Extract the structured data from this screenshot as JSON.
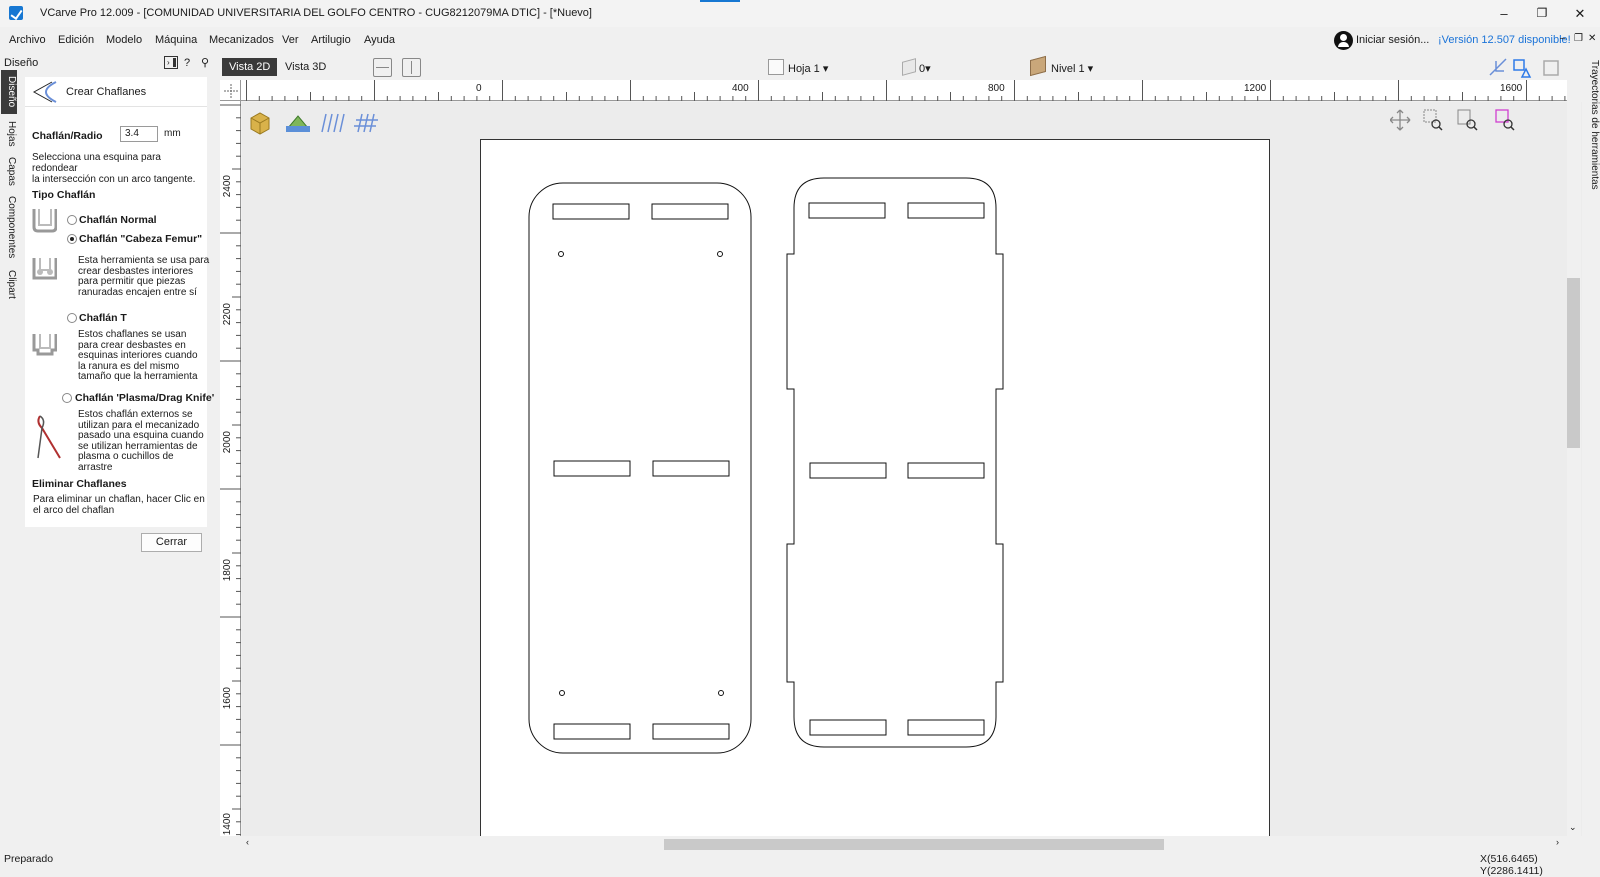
{
  "window": {
    "title": "VCarve Pro 12.009 - [COMUNIDAD UNIVERSITARIA DEL GOLFO CENTRO - CUG8212079MA DTIC] - [*Nuevo]",
    "minimize": "–",
    "restore": "❐",
    "close": "✕"
  },
  "menu": {
    "items": [
      "Archivo",
      "Edición",
      "Modelo",
      "Máquina",
      "Mecanizados",
      "Ver",
      "Artilugio",
      "Ayuda"
    ],
    "signin": "Iniciar sesión...",
    "version": "¡Versión 12.507 disponible!",
    "mini_min": "–",
    "mini_restore": "❐",
    "mini_close": "✕"
  },
  "left_tabs": [
    "Diseño",
    "Hojas",
    "Capas",
    "Componentes",
    "Clipart"
  ],
  "panel": {
    "header": "Diseño",
    "title": "Crear Chaflanes",
    "radius_label": "Chaflán/Radio",
    "radius_value": "3.4",
    "radius_unit": "mm",
    "instructions": [
      "Selecciona una esquina para",
      "redondear",
      " la intersección con un arco tangente."
    ],
    "type_heading": "Tipo Chaflán",
    "options": [
      {
        "label": "Chaflán Normal",
        "checked": false,
        "desc": []
      },
      {
        "label": "Chaflán \"Cabeza Femur\"",
        "checked": true,
        "desc": [
          "Esta herramienta se usa para",
          "crear desbastes interiores",
          "para permitir que piezas",
          "ranuradas encajen entre sí"
        ]
      },
      {
        "label": "Chaflán T",
        "checked": false,
        "desc": [
          "Estos chaflanes se usan",
          "para crear desbastes en",
          "esquinas interiores cuando",
          "la ranura es del mismo",
          "tamaño que la herramienta"
        ]
      },
      {
        "label": "Chaflán 'Plasma/Drag Knife'",
        "checked": false,
        "desc": [
          "Estos chaflán externos se",
          "utilizan para el mecanizado",
          "pasado una esquina cuando",
          "se utilizan herramientas de",
          "plasma o cuchillos de",
          "arrastre"
        ]
      }
    ],
    "remove_heading": "Eliminar Chaflanes",
    "remove_text": [
      "Para eliminar un chaflan, hacer Clic en",
      "el arco del chaflan"
    ],
    "close_button": "Cerrar"
  },
  "view_toolbar": {
    "tab_2d": "Vista 2D",
    "tab_3d": "Vista 3D",
    "sheet": "Hoja 1",
    "sheet_count": "0",
    "level": "Nivel 1"
  },
  "ruler": {
    "h_labels": [
      "0",
      "400",
      "800",
      "1200",
      "1600"
    ],
    "v_labels": [
      "2400",
      "2200",
      "2000",
      "1800",
      "1600",
      "1400"
    ]
  },
  "right_tab": "Trayectorias de herramientas",
  "status": {
    "text": "Preparado",
    "coords": "X(516.6465) Y(2286.1411)"
  }
}
